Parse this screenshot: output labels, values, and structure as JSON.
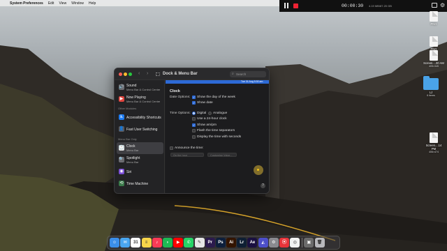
{
  "menubar": {
    "apple_icon": "apple-icon",
    "items": [
      "System Preferences",
      "Edit",
      "View",
      "Window",
      "Help"
    ]
  },
  "recorder": {
    "time": "00:00:30",
    "size": "4.19 MB/87.20 GB"
  },
  "window": {
    "title": "Dock & Menu Bar",
    "search_placeholder": "Search",
    "sidebar": {
      "items_top": [
        {
          "name": "Sound",
          "sub": "Menu Bar & Control Centre",
          "color": "#6d6d72",
          "glyph": "🔊"
        },
        {
          "name": "Now Playing",
          "sub": "Menu Bar & Control Centre",
          "color": "#e0443e",
          "glyph": "▶"
        }
      ],
      "other_modules_heading": "Other Modules",
      "items_other": [
        {
          "name": "Accessibility Shortcuts",
          "color": "#1e7cf2",
          "glyph": "♿"
        },
        {
          "name": "Fast User Switching",
          "color": "#5a5a5e",
          "glyph": "👤"
        }
      ],
      "menu_bar_only_heading": "Menu Bar Only",
      "items_menubar": [
        {
          "name": "Clock",
          "sub": "Menu Bar",
          "color": "#e8e8e8",
          "glyph": "🕐",
          "selected": true
        },
        {
          "name": "Spotlight",
          "sub": "Menu Bar",
          "color": "#6d6d72",
          "glyph": "🔍"
        },
        {
          "name": "Siri",
          "color": "#7b4ed6",
          "glyph": "◉"
        },
        {
          "name": "Time Machine",
          "color": "#3a7a4a",
          "glyph": "⟲"
        }
      ]
    },
    "preview_text": "Tue 31 Aug 5:30 am",
    "content": {
      "heading": "Clock",
      "date_label": "Date Options:",
      "show_day": "Show the day of the week",
      "show_date": "Show date",
      "time_label": "Time Options:",
      "digital": "Digital",
      "analogue": "Analogue",
      "use_24": "Use a 24-hour clock",
      "show_ampm": "Show am/pm",
      "flash": "Flash the time separators",
      "seconds": "Display the time with seconds",
      "announce": "Announce the time:",
      "interval_value": "On the hour",
      "voice_value": "Customise Voice...",
      "help": "?"
    }
  },
  "desktop": [
    {
      "name": "PNG",
      "sub": ""
    },
    {
      "name": "PNG",
      "sub": ""
    },
    {
      "name": "Screen....30 AM",
      "sub": "405×345"
    },
    {
      "name": "LJ",
      "sub": "6 items"
    },
    {
      "name": "Screen....14 PM",
      "sub": "406×474"
    }
  ],
  "dock": [
    {
      "name": "finder",
      "color": "#3b8ee8",
      "glyph": "☺"
    },
    {
      "name": "mail",
      "color": "#4aa6f0",
      "glyph": "✉"
    },
    {
      "name": "calendar",
      "color": "#ffffff",
      "glyph": "31"
    },
    {
      "name": "notes",
      "color": "#f7d54a",
      "glyph": "≡"
    },
    {
      "name": "music",
      "color": "#fa3b56",
      "glyph": "♪"
    },
    {
      "name": "spotify",
      "color": "#1db954",
      "glyph": "◗"
    },
    {
      "name": "youtube",
      "color": "#ff0000",
      "glyph": "▶"
    },
    {
      "name": "whatsapp",
      "color": "#25d366",
      "glyph": "✆"
    },
    {
      "name": "script-editor",
      "color": "#e6e6e6",
      "glyph": "✎"
    },
    {
      "name": "premiere",
      "color": "#2b1a4d",
      "glyph": "Pr"
    },
    {
      "name": "photoshop",
      "color": "#0d1f3c",
      "glyph": "Ps"
    },
    {
      "name": "illustrator",
      "color": "#331400",
      "glyph": "Ai"
    },
    {
      "name": "lightroom",
      "color": "#0e1f33",
      "glyph": "Lr"
    },
    {
      "name": "after-effects",
      "color": "#1a1040",
      "glyph": "Ae"
    },
    {
      "name": "vpn",
      "color": "#4d4fc9",
      "glyph": "◭"
    },
    {
      "name": "system-preferences",
      "color": "#8a8a8f",
      "glyph": "⚙"
    },
    {
      "name": "screen-recorder",
      "color": "#e8343a",
      "glyph": "⦿"
    },
    {
      "name": "chrome",
      "color": "#f2f2f2",
      "glyph": "◎"
    },
    {
      "name": "preview",
      "color": "#6b6b6b",
      "glyph": "▣"
    },
    {
      "name": "trash",
      "color": "#b8b8bc",
      "glyph": "🗑"
    }
  ]
}
